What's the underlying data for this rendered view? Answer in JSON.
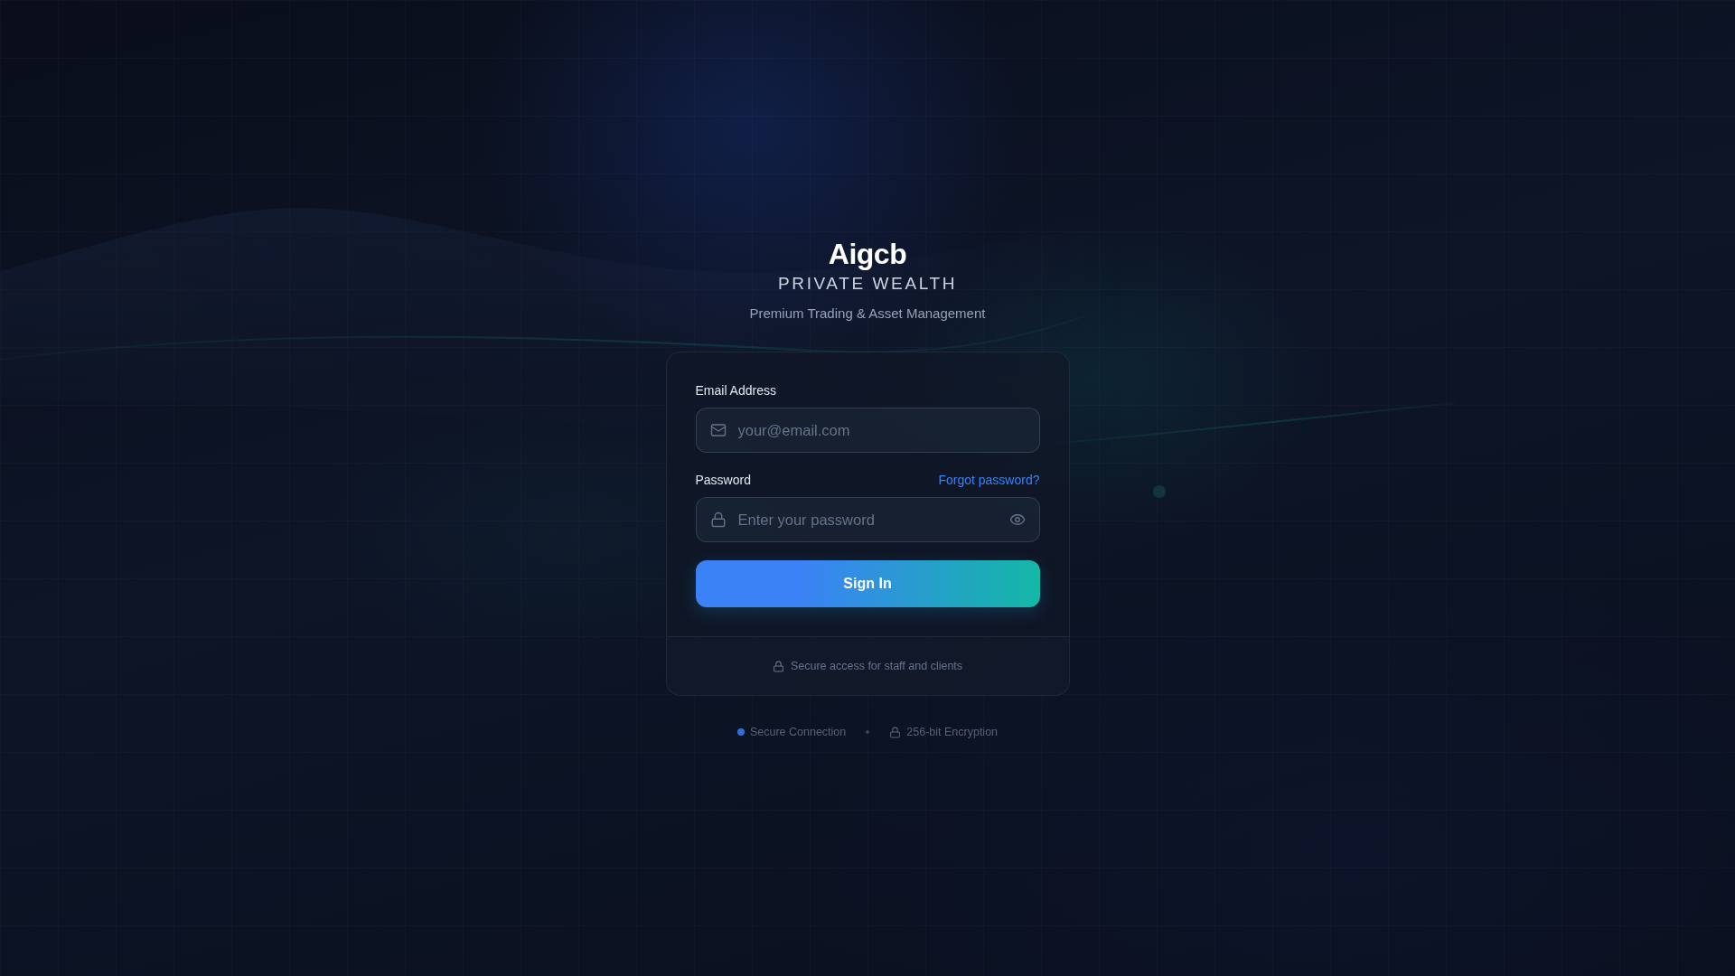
{
  "brand": {
    "name": "Aigcb",
    "tagline": "PRIVATE WEALTH",
    "subtitle": "Premium Trading & Asset Management"
  },
  "login_form": {
    "fields": [
      {
        "kind": "email",
        "label": "Email Address",
        "placeholder": "your@email.com"
      },
      {
        "kind": "password",
        "label": "Password",
        "link": "Forgot password?",
        "placeholder": "Enter your password"
      }
    ],
    "submit_button": "Sign In",
    "note": "Secure access for staff and clients"
  },
  "security_badges": [
    {
      "kind": "status",
      "label": "Secure Connection"
    },
    {
      "kind": "lock",
      "label": "256-bit Encryption"
    }
  ]
}
